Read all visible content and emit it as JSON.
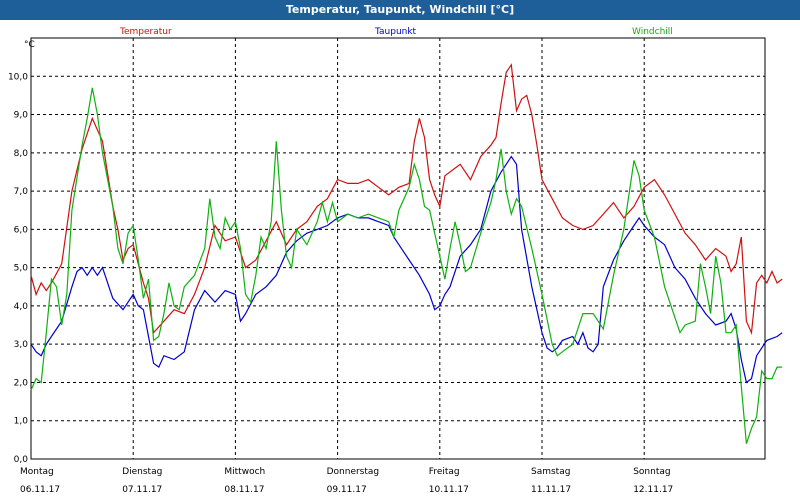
{
  "window": {
    "title": "Temperatur, Taupunkt, Windchill [°C]"
  },
  "chart_data": {
    "type": "line",
    "title": "Temperatur, Taupunkt, Windchill [°C]",
    "ylabel": "°C",
    "ylim": [
      0,
      11
    ],
    "yticks": [
      "0,0",
      "1,0",
      "2,0",
      "3,0",
      "4,0",
      "5,0",
      "6,0",
      "7,0",
      "8,0",
      "9,0",
      "10,0"
    ],
    "xlim": [
      0,
      7
    ],
    "xticks": [
      {
        "day": "Montag",
        "date": "06.11.17"
      },
      {
        "day": "Dienstag",
        "date": "07.11.17"
      },
      {
        "day": "Mittwoch",
        "date": "08.11.17"
      },
      {
        "day": "Donnerstag",
        "date": "09.11.17"
      },
      {
        "day": "Freitag",
        "date": "10.11.17"
      },
      {
        "day": "Samstag",
        "date": "11.11.17"
      },
      {
        "day": "Sonntag",
        "date": "12.11.17"
      }
    ],
    "grid": true,
    "legend_position": "top",
    "series": [
      {
        "name": "Temperatur",
        "color": "#d01010",
        "points": [
          [
            0,
            4.8
          ],
          [
            0.05,
            4.3
          ],
          [
            0.1,
            4.6
          ],
          [
            0.15,
            4.4
          ],
          [
            0.2,
            4.6
          ],
          [
            0.3,
            5.1
          ],
          [
            0.4,
            7.0
          ],
          [
            0.5,
            8.1
          ],
          [
            0.6,
            8.9
          ],
          [
            0.7,
            8.3
          ],
          [
            0.8,
            6.6
          ],
          [
            0.85,
            6.0
          ],
          [
            0.9,
            5.2
          ],
          [
            0.95,
            5.5
          ],
          [
            1.0,
            5.6
          ],
          [
            1.1,
            4.6
          ],
          [
            1.15,
            4.2
          ],
          [
            1.2,
            3.3
          ],
          [
            1.3,
            3.6
          ],
          [
            1.4,
            3.9
          ],
          [
            1.5,
            3.8
          ],
          [
            1.6,
            4.3
          ],
          [
            1.7,
            5.0
          ],
          [
            1.8,
            6.1
          ],
          [
            1.85,
            5.9
          ],
          [
            1.9,
            5.7
          ],
          [
            2.0,
            5.8
          ],
          [
            2.1,
            5.0
          ],
          [
            2.2,
            5.2
          ],
          [
            2.3,
            5.7
          ],
          [
            2.4,
            6.2
          ],
          [
            2.5,
            5.6
          ],
          [
            2.6,
            6.0
          ],
          [
            2.7,
            6.2
          ],
          [
            2.8,
            6.6
          ],
          [
            2.9,
            6.8
          ],
          [
            3.0,
            7.3
          ],
          [
            3.1,
            7.2
          ],
          [
            3.2,
            7.2
          ],
          [
            3.3,
            7.3
          ],
          [
            3.4,
            7.1
          ],
          [
            3.5,
            6.9
          ],
          [
            3.6,
            7.1
          ],
          [
            3.7,
            7.2
          ],
          [
            3.75,
            8.3
          ],
          [
            3.8,
            8.9
          ],
          [
            3.85,
            8.4
          ],
          [
            3.9,
            7.3
          ],
          [
            3.95,
            6.9
          ],
          [
            4.0,
            6.6
          ],
          [
            4.05,
            7.4
          ],
          [
            4.15,
            7.6
          ],
          [
            4.2,
            7.7
          ],
          [
            4.3,
            7.3
          ],
          [
            4.4,
            7.9
          ],
          [
            4.5,
            8.2
          ],
          [
            4.55,
            8.4
          ],
          [
            4.6,
            9.3
          ],
          [
            4.65,
            10.1
          ],
          [
            4.7,
            10.3
          ],
          [
            4.75,
            9.1
          ],
          [
            4.8,
            9.4
          ],
          [
            4.85,
            9.5
          ],
          [
            4.9,
            9.0
          ],
          [
            4.95,
            8.2
          ],
          [
            5.0,
            7.3
          ],
          [
            5.1,
            6.8
          ],
          [
            5.2,
            6.3
          ],
          [
            5.3,
            6.1
          ],
          [
            5.4,
            6.0
          ],
          [
            5.5,
            6.1
          ],
          [
            5.6,
            6.4
          ],
          [
            5.7,
            6.7
          ],
          [
            5.8,
            6.3
          ],
          [
            5.9,
            6.6
          ],
          [
            6.0,
            7.1
          ],
          [
            6.1,
            7.3
          ],
          [
            6.2,
            6.9
          ],
          [
            6.3,
            6.4
          ],
          [
            6.4,
            5.9
          ],
          [
            6.5,
            5.6
          ],
          [
            6.6,
            5.2
          ],
          [
            6.7,
            5.5
          ],
          [
            6.8,
            5.3
          ],
          [
            6.85,
            4.9
          ],
          [
            6.9,
            5.1
          ],
          [
            6.95,
            5.8
          ],
          [
            7.0,
            3.6
          ],
          [
            7.05,
            3.3
          ],
          [
            7.1,
            4.6
          ],
          [
            7.15,
            4.8
          ],
          [
            7.2,
            4.6
          ],
          [
            7.25,
            4.9
          ],
          [
            7.3,
            4.6
          ],
          [
            7.35,
            4.7
          ]
        ]
      },
      {
        "name": "Taupunkt",
        "color": "#0000cc",
        "points": [
          [
            0,
            3.0
          ],
          [
            0.05,
            2.8
          ],
          [
            0.1,
            2.7
          ],
          [
            0.15,
            3.0
          ],
          [
            0.2,
            3.2
          ],
          [
            0.3,
            3.6
          ],
          [
            0.4,
            4.5
          ],
          [
            0.45,
            4.9
          ],
          [
            0.5,
            5.0
          ],
          [
            0.55,
            4.8
          ],
          [
            0.6,
            5.0
          ],
          [
            0.65,
            4.8
          ],
          [
            0.7,
            5.0
          ],
          [
            0.8,
            4.2
          ],
          [
            0.9,
            3.9
          ],
          [
            0.95,
            4.1
          ],
          [
            1.0,
            4.3
          ],
          [
            1.05,
            4.0
          ],
          [
            1.1,
            3.9
          ],
          [
            1.15,
            3.2
          ],
          [
            1.2,
            2.5
          ],
          [
            1.25,
            2.4
          ],
          [
            1.3,
            2.7
          ],
          [
            1.4,
            2.6
          ],
          [
            1.5,
            2.8
          ],
          [
            1.6,
            3.9
          ],
          [
            1.7,
            4.4
          ],
          [
            1.8,
            4.1
          ],
          [
            1.9,
            4.4
          ],
          [
            2.0,
            4.3
          ],
          [
            2.05,
            3.6
          ],
          [
            2.1,
            3.8
          ],
          [
            2.2,
            4.3
          ],
          [
            2.3,
            4.5
          ],
          [
            2.4,
            4.8
          ],
          [
            2.5,
            5.4
          ],
          [
            2.6,
            5.7
          ],
          [
            2.7,
            5.9
          ],
          [
            2.8,
            6.0
          ],
          [
            2.9,
            6.1
          ],
          [
            3.0,
            6.3
          ],
          [
            3.1,
            6.4
          ],
          [
            3.2,
            6.3
          ],
          [
            3.3,
            6.3
          ],
          [
            3.4,
            6.2
          ],
          [
            3.5,
            6.1
          ],
          [
            3.55,
            5.8
          ],
          [
            3.6,
            5.6
          ],
          [
            3.7,
            5.2
          ],
          [
            3.8,
            4.8
          ],
          [
            3.9,
            4.3
          ],
          [
            3.95,
            3.9
          ],
          [
            4.0,
            4.0
          ],
          [
            4.05,
            4.3
          ],
          [
            4.1,
            4.5
          ],
          [
            4.2,
            5.3
          ],
          [
            4.3,
            5.6
          ],
          [
            4.4,
            6.0
          ],
          [
            4.5,
            7.0
          ],
          [
            4.6,
            7.5
          ],
          [
            4.65,
            7.7
          ],
          [
            4.7,
            7.9
          ],
          [
            4.75,
            7.7
          ],
          [
            4.8,
            6.0
          ],
          [
            4.9,
            4.5
          ],
          [
            5.0,
            3.3
          ],
          [
            5.05,
            2.9
          ],
          [
            5.1,
            2.8
          ],
          [
            5.15,
            2.9
          ],
          [
            5.2,
            3.1
          ],
          [
            5.3,
            3.2
          ],
          [
            5.35,
            3.0
          ],
          [
            5.4,
            3.3
          ],
          [
            5.45,
            2.9
          ],
          [
            5.5,
            2.8
          ],
          [
            5.55,
            3.0
          ],
          [
            5.6,
            4.5
          ],
          [
            5.7,
            5.2
          ],
          [
            5.8,
            5.7
          ],
          [
            5.9,
            6.1
          ],
          [
            5.95,
            6.3
          ],
          [
            6.0,
            6.1
          ],
          [
            6.1,
            5.8
          ],
          [
            6.2,
            5.6
          ],
          [
            6.3,
            5.0
          ],
          [
            6.4,
            4.7
          ],
          [
            6.5,
            4.2
          ],
          [
            6.6,
            3.8
          ],
          [
            6.7,
            3.5
          ],
          [
            6.8,
            3.6
          ],
          [
            6.85,
            3.8
          ],
          [
            6.9,
            3.4
          ],
          [
            6.95,
            2.6
          ],
          [
            7.0,
            2.0
          ],
          [
            7.05,
            2.1
          ],
          [
            7.1,
            2.7
          ],
          [
            7.2,
            3.1
          ],
          [
            7.3,
            3.2
          ],
          [
            7.35,
            3.3
          ]
        ]
      },
      {
        "name": "Windchill",
        "color": "#10b010",
        "points": [
          [
            0,
            1.8
          ],
          [
            0.05,
            2.1
          ],
          [
            0.1,
            2.0
          ],
          [
            0.15,
            3.3
          ],
          [
            0.2,
            4.7
          ],
          [
            0.25,
            4.5
          ],
          [
            0.3,
            3.5
          ],
          [
            0.35,
            4.3
          ],
          [
            0.4,
            6.5
          ],
          [
            0.5,
            8.2
          ],
          [
            0.55,
            8.9
          ],
          [
            0.6,
            9.7
          ],
          [
            0.65,
            9.0
          ],
          [
            0.7,
            8.0
          ],
          [
            0.8,
            6.6
          ],
          [
            0.85,
            5.5
          ],
          [
            0.9,
            5.1
          ],
          [
            0.95,
            5.9
          ],
          [
            1.0,
            6.1
          ],
          [
            1.05,
            5.2
          ],
          [
            1.1,
            4.2
          ],
          [
            1.15,
            4.7
          ],
          [
            1.2,
            3.1
          ],
          [
            1.25,
            3.2
          ],
          [
            1.3,
            3.8
          ],
          [
            1.35,
            4.6
          ],
          [
            1.4,
            4.0
          ],
          [
            1.45,
            3.9
          ],
          [
            1.5,
            4.5
          ],
          [
            1.6,
            4.8
          ],
          [
            1.7,
            5.5
          ],
          [
            1.75,
            6.8
          ],
          [
            1.8,
            5.8
          ],
          [
            1.85,
            5.5
          ],
          [
            1.9,
            6.3
          ],
          [
            1.95,
            6.0
          ],
          [
            2.0,
            6.2
          ],
          [
            2.05,
            5.5
          ],
          [
            2.1,
            4.3
          ],
          [
            2.15,
            4.1
          ],
          [
            2.2,
            4.8
          ],
          [
            2.25,
            5.8
          ],
          [
            2.3,
            5.5
          ],
          [
            2.35,
            6.2
          ],
          [
            2.4,
            8.3
          ],
          [
            2.45,
            6.5
          ],
          [
            2.5,
            5.3
          ],
          [
            2.55,
            5.0
          ],
          [
            2.6,
            6.0
          ],
          [
            2.7,
            5.6
          ],
          [
            2.8,
            6.2
          ],
          [
            2.85,
            6.7
          ],
          [
            2.9,
            6.2
          ],
          [
            2.95,
            6.7
          ],
          [
            3.0,
            6.2
          ],
          [
            3.1,
            6.4
          ],
          [
            3.2,
            6.3
          ],
          [
            3.3,
            6.4
          ],
          [
            3.4,
            6.3
          ],
          [
            3.5,
            6.2
          ],
          [
            3.55,
            5.8
          ],
          [
            3.6,
            6.5
          ],
          [
            3.7,
            7.1
          ],
          [
            3.75,
            7.7
          ],
          [
            3.8,
            7.3
          ],
          [
            3.85,
            6.6
          ],
          [
            3.9,
            6.5
          ],
          [
            4.0,
            5.3
          ],
          [
            4.05,
            4.7
          ],
          [
            4.1,
            5.5
          ],
          [
            4.15,
            6.2
          ],
          [
            4.2,
            5.6
          ],
          [
            4.25,
            4.9
          ],
          [
            4.3,
            5.0
          ],
          [
            4.4,
            5.9
          ],
          [
            4.5,
            6.7
          ],
          [
            4.55,
            7.3
          ],
          [
            4.6,
            8.1
          ],
          [
            4.65,
            7.0
          ],
          [
            4.7,
            6.4
          ],
          [
            4.75,
            6.8
          ],
          [
            4.8,
            6.6
          ],
          [
            4.9,
            5.5
          ],
          [
            5.0,
            4.3
          ],
          [
            5.1,
            3.0
          ],
          [
            5.15,
            2.7
          ],
          [
            5.2,
            2.8
          ],
          [
            5.3,
            3.0
          ],
          [
            5.4,
            3.8
          ],
          [
            5.5,
            3.8
          ],
          [
            5.6,
            3.4
          ],
          [
            5.7,
            4.8
          ],
          [
            5.8,
            6.0
          ],
          [
            5.9,
            7.8
          ],
          [
            5.95,
            7.4
          ],
          [
            6.0,
            6.5
          ],
          [
            6.1,
            5.8
          ],
          [
            6.2,
            4.5
          ],
          [
            6.3,
            3.7
          ],
          [
            6.35,
            3.3
          ],
          [
            6.4,
            3.5
          ],
          [
            6.5,
            3.6
          ],
          [
            6.55,
            5.1
          ],
          [
            6.6,
            4.5
          ],
          [
            6.65,
            3.8
          ],
          [
            6.7,
            5.3
          ],
          [
            6.75,
            4.6
          ],
          [
            6.8,
            3.3
          ],
          [
            6.85,
            3.3
          ],
          [
            6.9,
            3.5
          ],
          [
            6.95,
            1.9
          ],
          [
            7.0,
            0.4
          ],
          [
            7.05,
            0.8
          ],
          [
            7.1,
            1.1
          ],
          [
            7.15,
            2.3
          ],
          [
            7.2,
            2.1
          ],
          [
            7.25,
            2.1
          ],
          [
            7.3,
            2.4
          ],
          [
            7.35,
            2.4
          ]
        ]
      }
    ]
  }
}
